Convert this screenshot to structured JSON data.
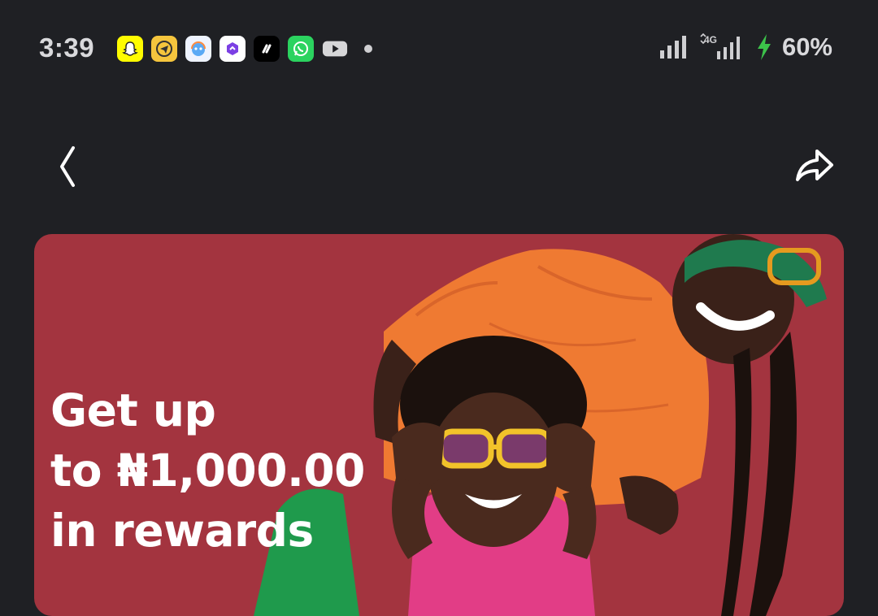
{
  "status_bar": {
    "time": "3:39",
    "notification_icons": [
      "snapchat-icon",
      "telegram-icon",
      "chat-bot-icon",
      "app-icon",
      "app-icon",
      "whatsapp-icon",
      "youtube-icon"
    ],
    "network": "4G",
    "battery": "60%",
    "battery_color": "#3cc24a"
  },
  "nav": {
    "back_icon": "chevron-left-icon",
    "share_icon": "share-arrow-icon"
  },
  "banner": {
    "line1": "Get up",
    "line2": "to ₦1,000.00",
    "line3": "in rewards",
    "background_color": "#a3343f"
  }
}
